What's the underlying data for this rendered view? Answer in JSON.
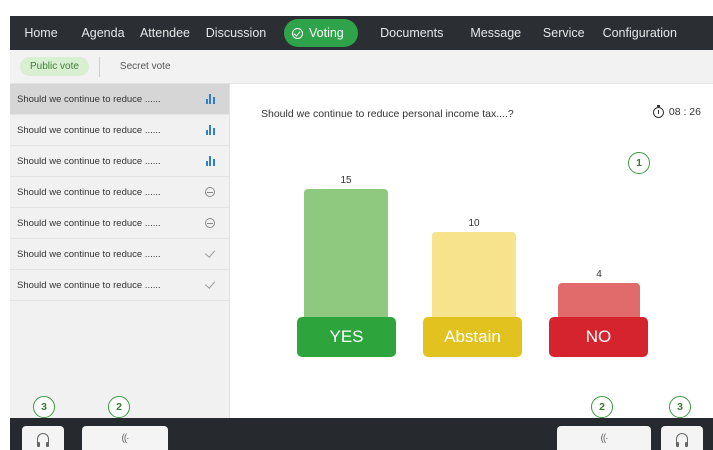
{
  "nav": {
    "items": [
      "Home",
      "Agenda",
      "Attendee",
      "Discussion",
      "Voting",
      "Documents",
      "Message",
      "Service",
      "Configuration"
    ],
    "active": "Voting"
  },
  "subtabs": {
    "public": "Public vote",
    "secret": "Secret vote"
  },
  "list": [
    {
      "text": "Should we continue to reduce ......",
      "status": "bar-chart-icon"
    },
    {
      "text": "Should we continue to reduce ......",
      "status": "bar-chart-icon"
    },
    {
      "text": "Should we continue to reduce ......",
      "status": "bar-chart-icon"
    },
    {
      "text": "Should we continue to reduce ......",
      "status": "pending-icon"
    },
    {
      "text": "Should we continue to reduce ......",
      "status": "pending-icon"
    },
    {
      "text": "Should we continue to reduce ......",
      "status": "check-icon"
    },
    {
      "text": "Should we continue to reduce ......",
      "status": "check-icon"
    }
  ],
  "main": {
    "question": "Should we continue to reduce personal income tax....?",
    "timer": "08 : 26"
  },
  "callouts": {
    "one": "1",
    "two": "2",
    "three": "3"
  },
  "chart_data": {
    "type": "bar",
    "categories": [
      "YES",
      "Abstain",
      "NO"
    ],
    "values": [
      15,
      10,
      4
    ],
    "colors": {
      "bars": [
        "#8ec97f",
        "#f6e38c",
        "#e16b6b"
      ],
      "labels": [
        "#2ea43c",
        "#e2c21f",
        "#d5242d"
      ]
    },
    "title": "",
    "xlabel": "",
    "ylabel": ""
  }
}
